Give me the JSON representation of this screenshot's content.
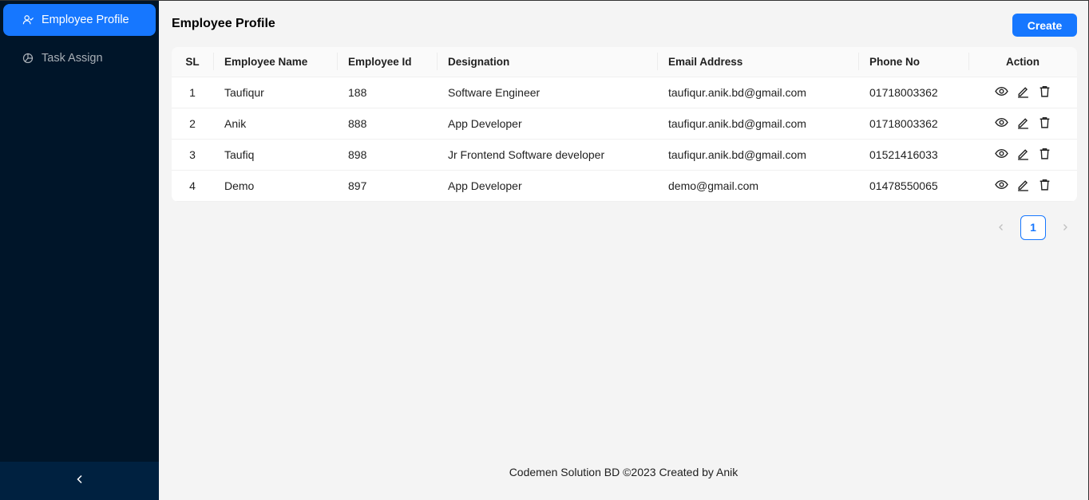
{
  "sidebar": {
    "items": [
      {
        "label": "Employee Profile",
        "icon": "user-icon",
        "active": true
      },
      {
        "label": "Task Assign",
        "icon": "pie-chart-icon",
        "active": false
      }
    ],
    "collapse_icon": "chevron-left-icon"
  },
  "header": {
    "title": "Employee Profile",
    "create_label": "Create"
  },
  "table": {
    "columns": [
      "SL",
      "Employee Name",
      "Employee Id",
      "Designation",
      "Email Address",
      "Phone No",
      "Action"
    ],
    "rows": [
      {
        "sl": "1",
        "name": "Taufiqur",
        "id": "188",
        "designation": "Software Engineer",
        "email": "taufiqur.anik.bd@gmail.com",
        "phone": "01718003362"
      },
      {
        "sl": "2",
        "name": "Anik",
        "id": "888",
        "designation": "App Developer",
        "email": "taufiqur.anik.bd@gmail.com",
        "phone": "01718003362"
      },
      {
        "sl": "3",
        "name": "Taufiq",
        "id": "898",
        "designation": "Jr Frontend Software developer",
        "email": "taufiqur.anik.bd@gmail.com",
        "phone": "01521416033"
      },
      {
        "sl": "4",
        "name": "Demo",
        "id": "897",
        "designation": "App Developer",
        "email": "demo@gmail.com",
        "phone": "01478550065"
      }
    ],
    "action_icons": [
      "eye-icon",
      "edit-icon",
      "delete-icon"
    ]
  },
  "pagination": {
    "current": "1",
    "prev_icon": "chevron-left-icon",
    "next_icon": "chevron-right-icon"
  },
  "footer": {
    "text": "Codemen Solution BD ©2023 Created by Anik"
  },
  "colors": {
    "sidebar_bg": "#001529",
    "accent": "#1677ff",
    "page_bg": "#f4f4f4"
  }
}
